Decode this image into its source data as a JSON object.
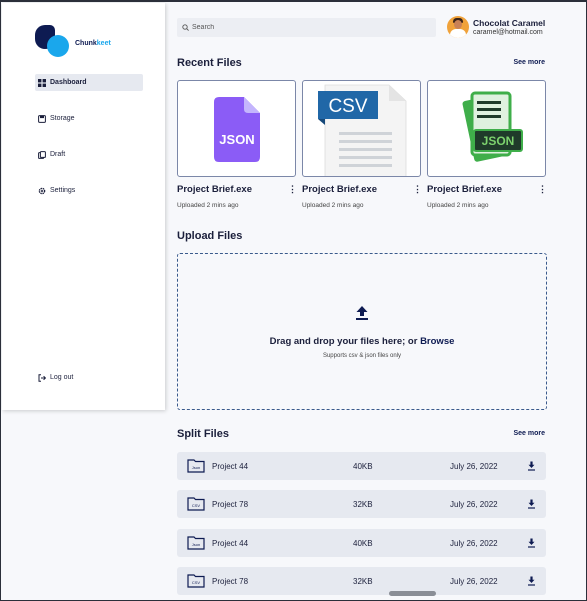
{
  "brand": {
    "name_part1": "Chunk",
    "name_part2": "keet",
    "dark": "#0e1b52",
    "light": "#1aa7ec"
  },
  "sidebar": {
    "items": [
      {
        "label": "Dashboard",
        "icon": "dashboard-icon",
        "active": true
      },
      {
        "label": "Storage",
        "icon": "storage-icon"
      },
      {
        "label": "Draft",
        "icon": "draft-icon"
      },
      {
        "label": "Settings",
        "icon": "gear-icon"
      }
    ],
    "logout_label": "Log out"
  },
  "search": {
    "placeholder": "Search"
  },
  "profile": {
    "name": "Chocolat Caramel",
    "email": "caramel@hotmail.com"
  },
  "recent": {
    "title": "Recent Files",
    "see_more": "See more",
    "files": [
      {
        "name": "Project Brief.exe",
        "meta": "Uploaded 2 mins ago",
        "thumb": "json-file-icon",
        "badge": "JSON"
      },
      {
        "name": "Project Brief.exe",
        "meta": "Uploaded 2 mins ago",
        "thumb": "csv-file-icon",
        "badge": "CSV"
      },
      {
        "name": "Project Brief.exe",
        "meta": "Uploaded 2 mins ago",
        "thumb": "json-document-icon",
        "badge": "JSON"
      }
    ]
  },
  "upload": {
    "title": "Upload Files",
    "drag_text": "Drag and drop your files here; or ",
    "browse": "Browse",
    "support": "Supports csv & json files only"
  },
  "split": {
    "title": "Split Files",
    "see_more": "See more",
    "rows": [
      {
        "type": "Json",
        "name": "Project 44",
        "size": "40KB",
        "date": "July 26, 2022"
      },
      {
        "type": "CSV",
        "name": "Project 78",
        "size": "32KB",
        "date": "July 26, 2022"
      },
      {
        "type": "Json",
        "name": "Project 44",
        "size": "40KB",
        "date": "July 26, 2022"
      },
      {
        "type": "CSV",
        "name": "Project 78",
        "size": "32KB",
        "date": "July 26, 2022"
      }
    ]
  }
}
